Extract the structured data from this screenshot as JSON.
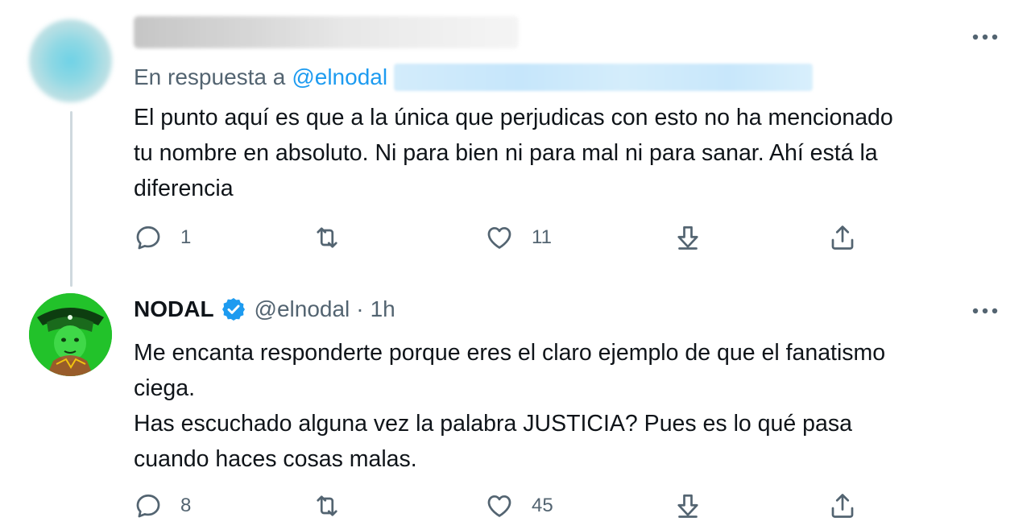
{
  "tweets": [
    {
      "reply_prefix": "En respuesta a",
      "reply_mention": "@elnodal",
      "text": "El punto aquí es que a la única que perjudicas con esto no ha mencionado\ntu nombre en absoluto. Ni para bien ni para mal ni para sanar. Ahí está la\ndiferencia",
      "reply_count": "1",
      "like_count": "11"
    },
    {
      "display_name": "NODAL",
      "handle": "@elnodal",
      "separator": "·",
      "time": "1h",
      "text": "Me encanta responderte porque eres el claro ejemplo de que el fanatismo\nciega.\nHas escuchado alguna vez la palabra JUSTICIA? Pues es lo qué pasa\ncuando haces cosas malas.",
      "reply_count": "8",
      "like_count": "45"
    }
  ],
  "icons": {
    "reply": "reply-icon",
    "retweet": "retweet-icon",
    "like": "heart-icon",
    "bookmark": "download-icon",
    "share": "share-icon",
    "more": "more-icon",
    "verified": "verified-badge-icon"
  },
  "colors": {
    "accent": "#1d9bf0",
    "secondary_text": "#536471",
    "primary_text": "#0f1419",
    "thread_line": "#cfd9de"
  }
}
